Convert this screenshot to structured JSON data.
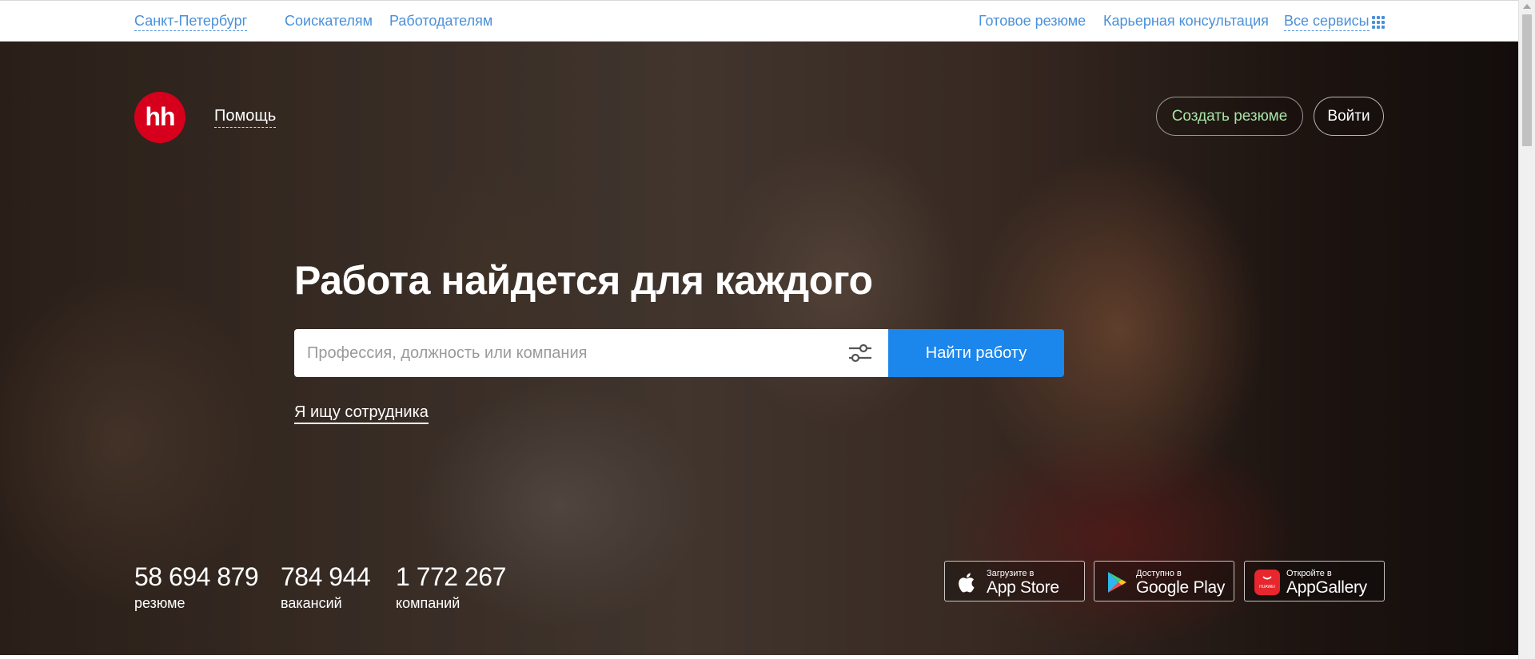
{
  "topbar": {
    "city": "Санкт-Петербург",
    "seekers": "Соискателям",
    "employers": "Работодателям",
    "ready_resume": "Готовое резюме",
    "career_consult": "Карьерная консультация",
    "all_services": "Все сервисы",
    "services_icon": "grid-icon"
  },
  "header": {
    "logo": "hh",
    "help": "Помощь",
    "create_resume": "Создать резюме",
    "login": "Войти"
  },
  "hero": {
    "headline": "Работа найдется для каждого",
    "search_placeholder": "Профессия, должность или компания",
    "search_value": "",
    "filter_icon": "sliders-icon",
    "find_button": "Найти работу",
    "employer_link": "Я ищу сотрудника"
  },
  "stats": [
    {
      "value": "58 694 879",
      "label": "резюме"
    },
    {
      "value": "784 944",
      "label": "вакансий"
    },
    {
      "value": "1 772 267",
      "label": "компаний"
    }
  ],
  "stores": [
    {
      "small": "Загрузите в",
      "big": "App Store",
      "icon": "apple-icon"
    },
    {
      "small": "Доступно в",
      "big": "Google Play",
      "icon": "google-play-icon"
    },
    {
      "small": "Откройте в",
      "big": "AppGallery",
      "icon": "huawei-appgallery-icon",
      "icon_text": "HUAWEI"
    }
  ],
  "colors": {
    "accent_blue": "#1b86eb",
    "link_blue": "#4a90d9",
    "brand_red": "#d6001c",
    "create_resume_green": "#a6e3a6"
  }
}
